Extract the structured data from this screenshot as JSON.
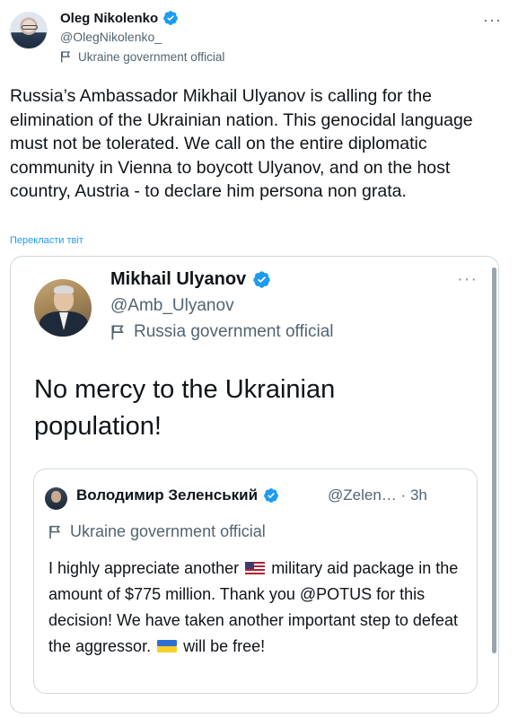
{
  "outer_tweet": {
    "author_name": "Oleg Nikolenko",
    "author_handle": "@OlegNikolenko_",
    "account_label": "Ukraine government official",
    "text": "Russia’s Ambassador Mikhail Ulyanov is calling for the elimination of the Ukrainian nation. This genocidal language must not be tolerated. We call on the entire diplomatic community in Vienna to boycott Ulyanov, and on the host country, Austria - to declare him persona non grata.",
    "translate_link": "Перекласти твіт",
    "more_menu": "···"
  },
  "quoted_tweet": {
    "author_name": "Mikhail Ulyanov",
    "author_handle": "@Amb_Ulyanov",
    "account_label": "Russia government official",
    "text": "No mercy to the Ukrainian population!",
    "more_menu": "···"
  },
  "nested_quote": {
    "author_name": "Володимир Зеленський",
    "author_handle": "@Zelen…",
    "separator": "·",
    "time": "3h",
    "account_label": "Ukraine government official",
    "text_part1": "I highly appreciate another",
    "text_part2": "military aid package in the amount of $775 million. Thank you @POTUS for this decision! We have taken another important step to defeat the aggressor.",
    "text_part3": "will be free!"
  },
  "colors": {
    "verified_blue": "#1d9bf0",
    "secondary_text": "#536471",
    "border": "#cfd9de"
  }
}
